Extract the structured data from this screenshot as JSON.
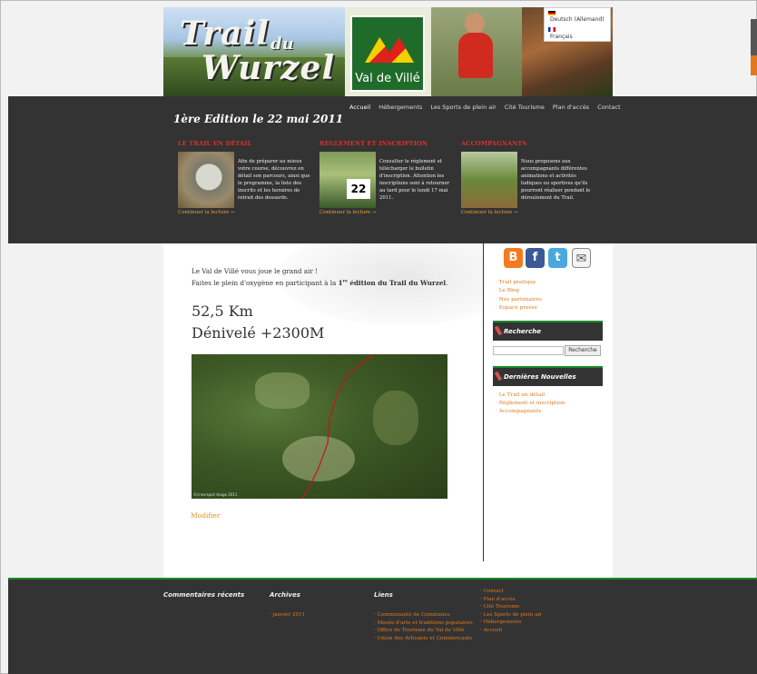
{
  "banner": {
    "title_trail": "Trail",
    "title_du": "du",
    "title_wurzel": "Wurzel",
    "logo_text": "Val de Villé"
  },
  "languages": [
    {
      "label": "Deutsch (Allemand)",
      "flag": "de"
    },
    {
      "label": "Français",
      "flag": "fr"
    }
  ],
  "nav": {
    "items": [
      "Accueil",
      "Hébergements",
      "Les Sports de plein air",
      "Cité Tourisme",
      "Plan d'accès",
      "Contact"
    ]
  },
  "edition": "1ère Edition le 22 mai 2011",
  "features": [
    {
      "title": "LE TRAIL EN DÉTAIL",
      "text": "Afin de préparer au mieux votre course, découvrez en détail son parcours, ainsi que le programme, la liste des inscrits et les horaires de retrait des dossards.",
      "more": "Continuer la lecture →"
    },
    {
      "title": "RÈGLEMENT ET INSCRIPTION",
      "text": "Consulter le règlement et télécharger le bulletin d'inscription. Attention les inscriptions sont à retourner au tard pour le lundi 17 mai 2011.",
      "more": "Continuer la lecture →",
      "bib": "22"
    },
    {
      "title": "ACCOMPAGNANTS",
      "text": "Nous proposons aux accompagnants différentes animations et activités ludiques ou sportives qu'ils pourront réaliser pendant le déroulement du Trail.",
      "more": "Continuer la lecture →"
    }
  ],
  "main": {
    "intro1": "Le Val de Villé vous joue le grand air !",
    "intro2_prefix": "Faites le plein d'oxygène en participant à la ",
    "intro2_ordinal": "1",
    "intro2_sup": "re",
    "intro2_bold": " édition du Trail du Wurzel",
    "intro2_suffix": ".",
    "distance": "52,5 Km",
    "elevation": "Dénivelé +2300M",
    "map_credit": "©cnes/spot image 2011",
    "modify": "Modifier"
  },
  "sidebar": {
    "links": [
      "Trail pratique",
      "Le Blog",
      "Nos partenaires",
      "Espace presse"
    ],
    "search_title": "Recherche",
    "search_button": "Recherche",
    "news_title": "Dernières Nouvelles",
    "news": [
      "Le Trail en détail",
      "Règlement et inscription",
      "Accompagnants"
    ]
  },
  "footer": {
    "recent_comments": "Commentaires récents",
    "archives": "Archives",
    "archives_items": [
      "janvier 2011"
    ],
    "links_title": "Liens",
    "links": [
      "Communauté de Communes",
      "Musée d'arts et traditions populaires",
      "Office de Tourisme du Val de Villé",
      "Union des Artisants et Commerçants"
    ],
    "pages": [
      "Contact",
      "Plan d'accès",
      "Cité Tourisme",
      "Les Sports de plein air",
      "Hébergements",
      "Accueil"
    ]
  }
}
